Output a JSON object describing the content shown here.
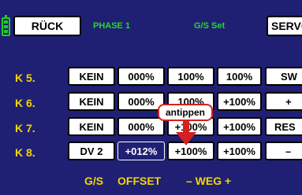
{
  "header": {
    "back_label": "RÜCK",
    "phase_label": "PHASE 1",
    "menu_title": "G/S Set",
    "servo_label": "SERVO"
  },
  "rows": [
    {
      "channel": "K 5.",
      "switch": "KEIN",
      "offset": "000%",
      "weg_minus": "100%",
      "weg_plus": "100%",
      "side": "SW"
    },
    {
      "channel": "K 6.",
      "switch": "KEIN",
      "offset": "000%",
      "weg_minus": "100%",
      "weg_plus": "+100%",
      "side": "+"
    },
    {
      "channel": "K 7.",
      "switch": "KEIN",
      "offset": "000%",
      "weg_minus": "+100%",
      "weg_plus": "+100%",
      "side": "RES"
    },
    {
      "channel": "K 8.",
      "switch": "DV 2",
      "offset": "+012%",
      "weg_minus": "+100%",
      "weg_plus": "+100%",
      "side": "–"
    }
  ],
  "footer": {
    "gs_label": "G/S",
    "offset_label": "OFFSET",
    "weg_label": "– WEG +"
  },
  "callout": {
    "label": "antippen"
  },
  "colors": {
    "background": "#1f1f73",
    "accent_yellow": "#f2d600",
    "header_green": "#22dd22",
    "callout_red": "#d42020",
    "active_value": "#2020d0"
  },
  "icons": {
    "battery": "battery-icon",
    "arrow": "arrow-down-icon"
  }
}
